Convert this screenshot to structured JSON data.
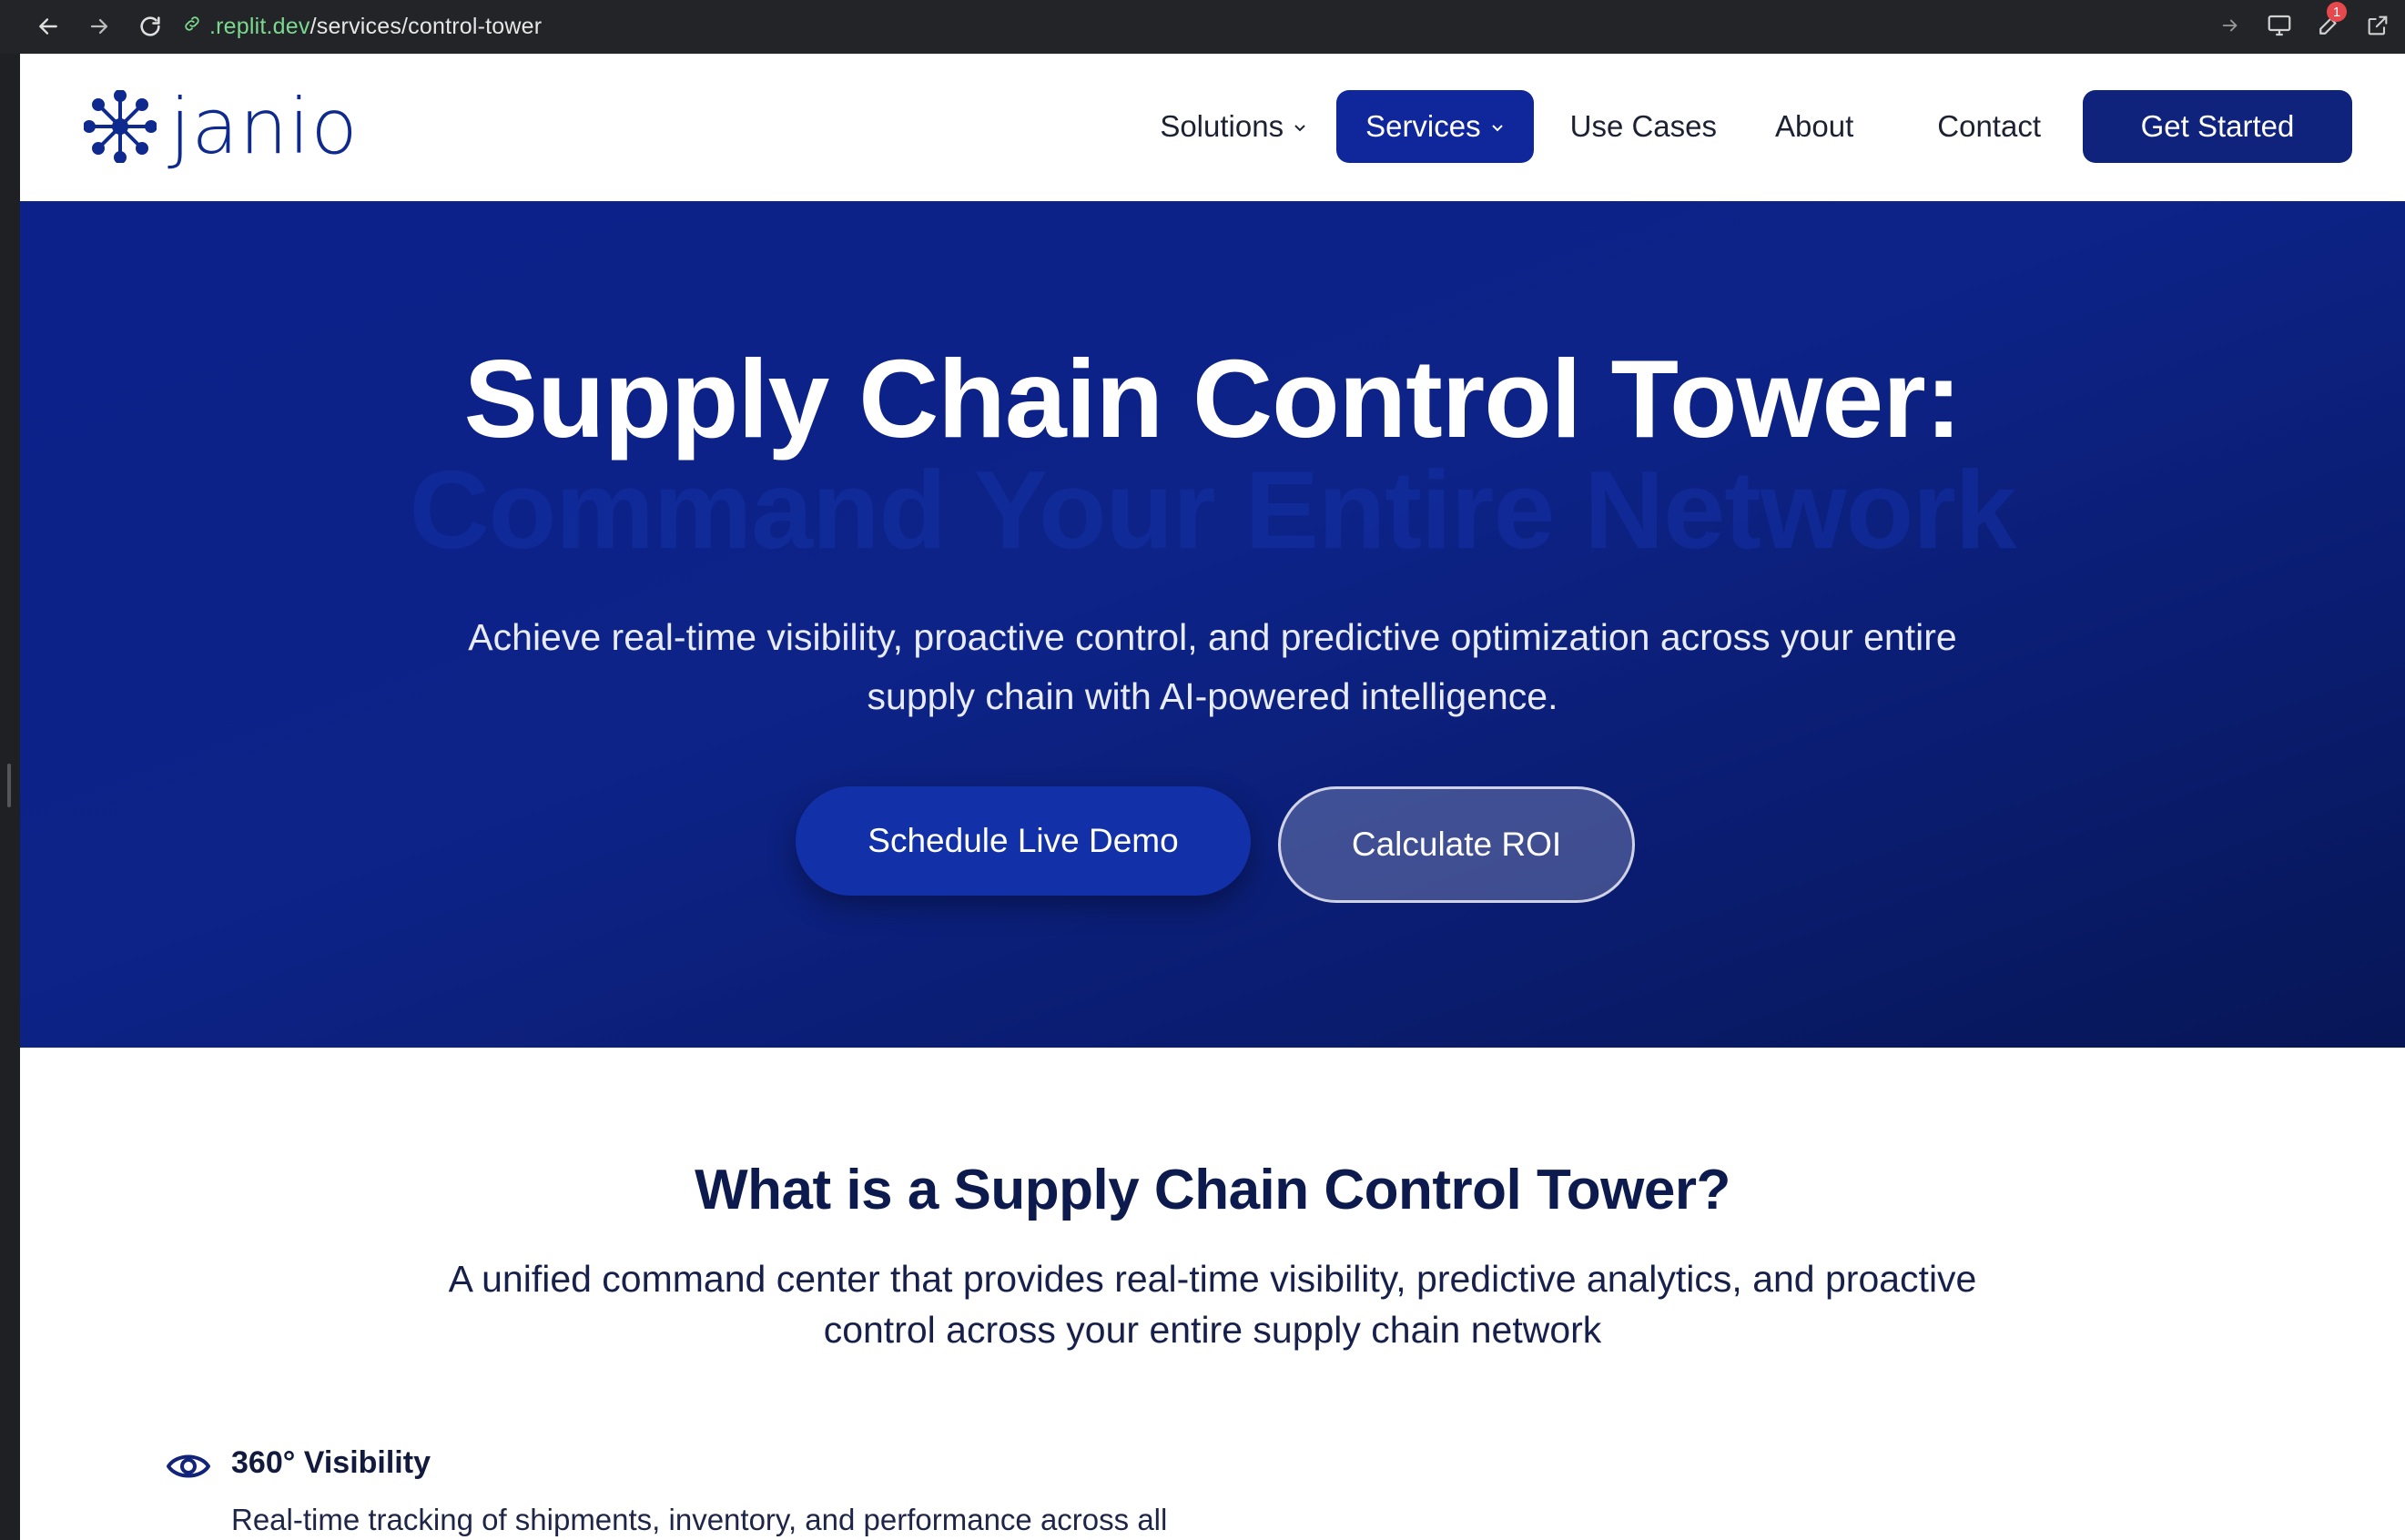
{
  "browser": {
    "url_domain": ".replit.dev",
    "url_path": "/services/control-tower",
    "notification_count": "1"
  },
  "header": {
    "logo_text": "janio",
    "nav": [
      {
        "label": "Solutions",
        "has_dropdown": true,
        "active": false
      },
      {
        "label": "Services",
        "has_dropdown": true,
        "active": true
      },
      {
        "label": "Use Cases",
        "has_dropdown": false,
        "active": false
      },
      {
        "label": "About",
        "has_dropdown": false,
        "active": false
      },
      {
        "label": "Contact",
        "has_dropdown": false,
        "active": false
      }
    ],
    "cta_label": "Get Started"
  },
  "hero": {
    "title": "Supply Chain Control Tower:",
    "subtitle": "Command Your Entire Network",
    "description_line1": "Achieve real-time visibility, proactive control, and predictive optimization across your entire",
    "description_line2": "supply chain with AI-powered intelligence.",
    "primary_button": "Schedule Live Demo",
    "secondary_button": "Calculate ROI"
  },
  "info": {
    "title": "What is a Supply Chain Control Tower?",
    "description_line1": "A unified command center that provides real-time visibility, predictive analytics, and proactive",
    "description_line2": "control across your entire supply chain network",
    "feature": {
      "icon": "eye-icon",
      "title": "360° Visibility",
      "description": "Real-time tracking of shipments, inventory, and performance across all"
    }
  },
  "colors": {
    "brand": "#0f2a8f",
    "hero_bg": "#0c218a",
    "button_primary": "#1230a8"
  }
}
